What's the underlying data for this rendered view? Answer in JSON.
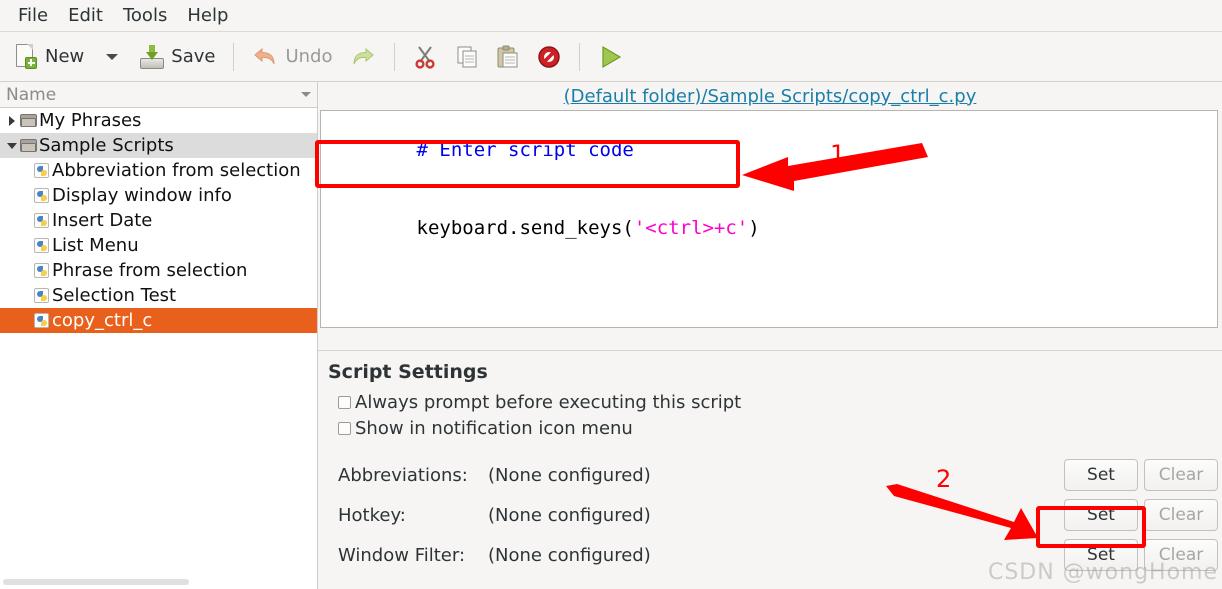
{
  "menubar": {
    "items": [
      {
        "label": "File"
      },
      {
        "label": "Edit"
      },
      {
        "label": "Tools"
      },
      {
        "label": "Help"
      }
    ]
  },
  "toolbar": {
    "new_label": "New",
    "save_label": "Save",
    "undo_label": "Undo",
    "icons": [
      "new-document-icon",
      "dropdown-caret-icon",
      "save-icon",
      "undo-icon",
      "redo-icon",
      "cut-icon",
      "copy-icon",
      "paste-icon",
      "delete-icon",
      "run-icon"
    ]
  },
  "sidebar": {
    "column_header": "Name",
    "tree": [
      {
        "label": "My Phrases",
        "type": "folder",
        "expanded": false,
        "depth": 0,
        "selected": false
      },
      {
        "label": "Sample Scripts",
        "type": "folder",
        "expanded": true,
        "depth": 0,
        "selected": false
      },
      {
        "label": "Abbreviation from selection",
        "type": "script",
        "depth": 1,
        "selected": false
      },
      {
        "label": "Display window info",
        "type": "script",
        "depth": 1,
        "selected": false
      },
      {
        "label": "Insert Date",
        "type": "script",
        "depth": 1,
        "selected": false
      },
      {
        "label": "List Menu",
        "type": "script",
        "depth": 1,
        "selected": false
      },
      {
        "label": "Phrase from selection",
        "type": "script",
        "depth": 1,
        "selected": false
      },
      {
        "label": "Selection Test",
        "type": "script",
        "depth": 1,
        "selected": false
      },
      {
        "label": "copy_ctrl_c",
        "type": "script",
        "depth": 1,
        "selected": true
      }
    ]
  },
  "main": {
    "path_link": "(Default folder)/Sample Scripts/copy_ctrl_c.py",
    "editor": {
      "comment_line": "# Enter script code",
      "code_prefix": "keyboard.send_keys(",
      "code_string": "'<ctrl>+c'",
      "code_suffix": ")"
    },
    "settings": {
      "title": "Script Settings",
      "checkboxes": [
        {
          "label": "Always prompt before executing this script",
          "checked": false
        },
        {
          "label": "Show in notification icon menu",
          "checked": false
        }
      ],
      "fields": [
        {
          "label": "Abbreviations:",
          "value": "(None configured)",
          "set_label": "Set",
          "clear_label": "Clear",
          "clear_disabled": true
        },
        {
          "label": "Hotkey:",
          "value": "(None configured)",
          "set_label": "Set",
          "clear_label": "Clear",
          "clear_disabled": true
        },
        {
          "label": "Window Filter:",
          "value": "(None configured)",
          "set_label": "Set",
          "clear_label": "Clear",
          "clear_disabled": true
        }
      ]
    }
  },
  "annotations": {
    "marker_1": "1",
    "marker_2": "2",
    "highlight_color": "#ff0000"
  },
  "watermark": "CSDN @wongHome"
}
